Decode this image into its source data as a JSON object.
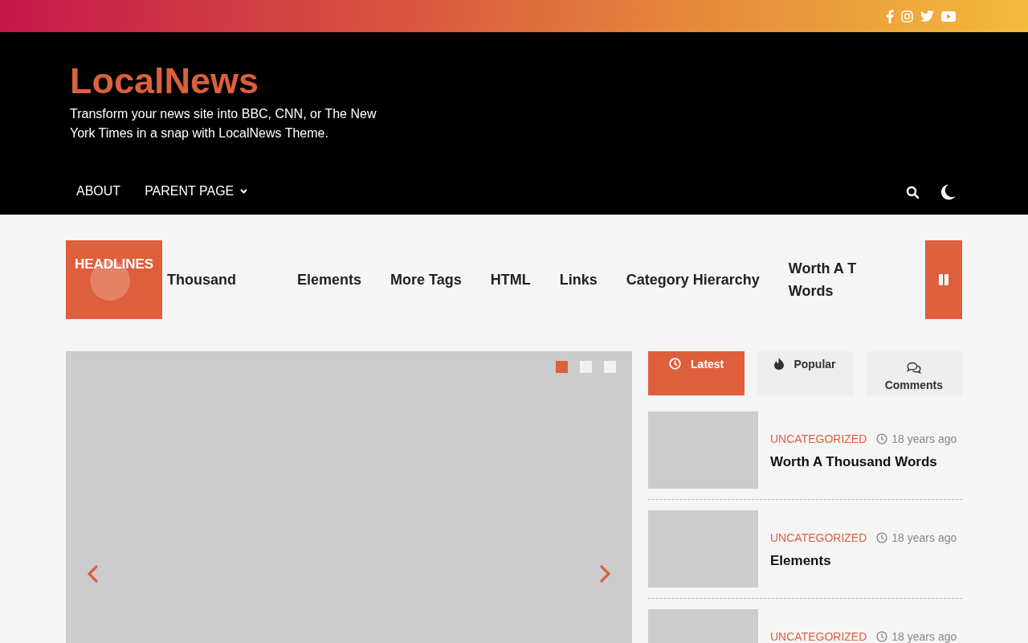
{
  "site": {
    "title": "LocalNews",
    "tagline": "Transform your news site into BBC, CNN, or The New York Times in a snap with LocalNews Theme."
  },
  "nav": [
    {
      "label": "ABOUT",
      "has_submenu": false
    },
    {
      "label": "PARENT PAGE",
      "has_submenu": true
    }
  ],
  "ticker": {
    "label": "HEADLINES",
    "items": [
      {
        "lines": [
          "Thousand"
        ]
      },
      {
        "lines": [
          "Elements"
        ]
      },
      {
        "lines": [
          "More Tags"
        ]
      },
      {
        "lines": [
          "HTML"
        ]
      },
      {
        "lines": [
          "Links"
        ]
      },
      {
        "lines": [
          "Category Hierarchy"
        ]
      },
      {
        "lines": [
          "Worth A T",
          "Words"
        ]
      }
    ]
  },
  "slider": {
    "dots": [
      {
        "selected": true
      },
      {
        "selected": false
      },
      {
        "selected": false
      }
    ]
  },
  "tabs": [
    {
      "label": "Latest",
      "kind": "clock",
      "selected": true
    },
    {
      "label": "Popular",
      "kind": "fire",
      "selected": false
    },
    {
      "label": "Comments",
      "kind": "comments",
      "selected": false
    }
  ],
  "posts": [
    {
      "category": "UNCATEGORIZED",
      "time": "18 years ago",
      "title": "Worth A Thousand Words"
    },
    {
      "category": "UNCATEGORIZED",
      "time": "18 years ago",
      "title": "Elements"
    },
    {
      "category": "UNCATEGORIZED",
      "time": "18 years ago"
    }
  ]
}
